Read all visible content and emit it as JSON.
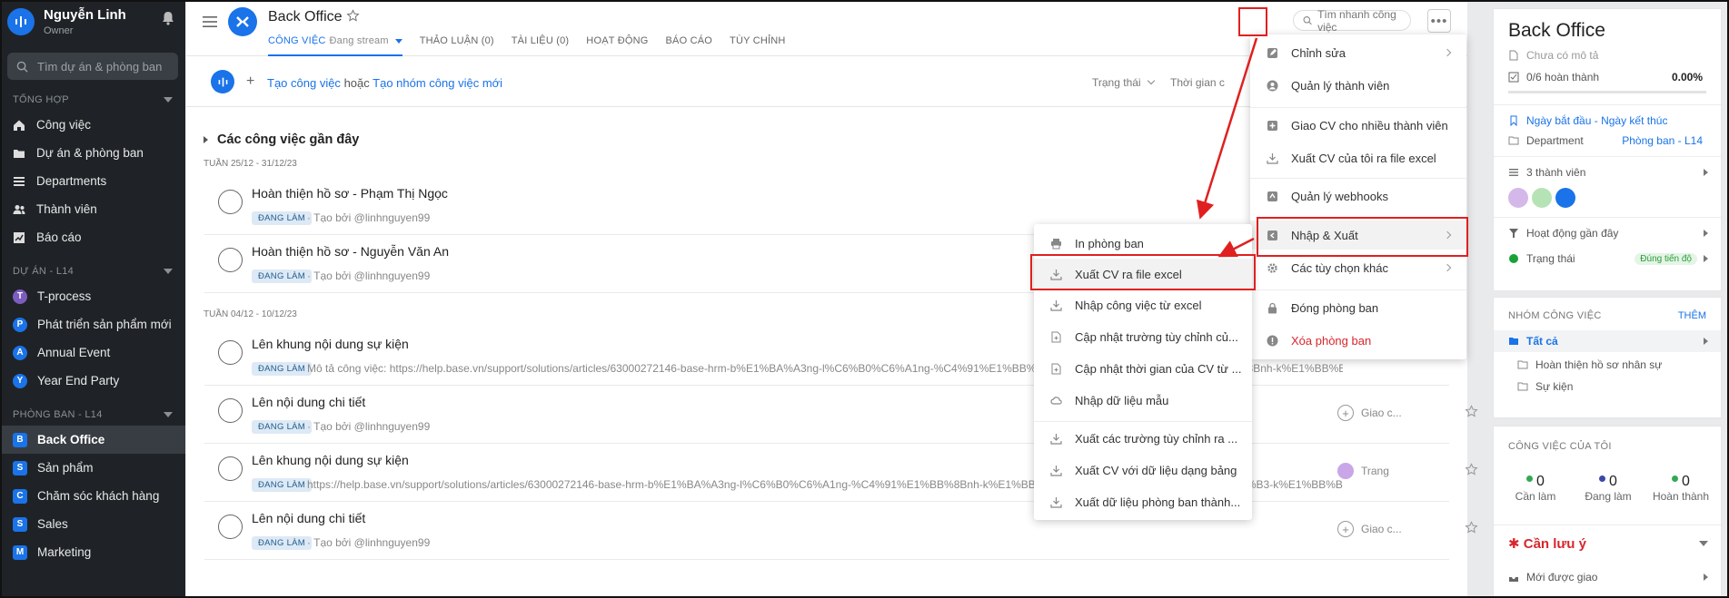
{
  "sidebar": {
    "user_name": "Nguyễn Linh",
    "user_role": "Owner",
    "search_placeholder": "Tìm dự án & phòng ban",
    "section_general": "TỔNG HỢP",
    "general_items": [
      {
        "label": "Công việc",
        "icon": "home-icon"
      },
      {
        "label": "Dự án & phòng ban",
        "icon": "folder-icon"
      },
      {
        "label": "Departments",
        "icon": "list-icon"
      },
      {
        "label": "Thành viên",
        "icon": "users-icon"
      },
      {
        "label": "Báo cáo",
        "icon": "chart-icon"
      }
    ],
    "section_projects": "DỰ ÁN - L14",
    "project_items": [
      {
        "label": "T-process",
        "badge": "T"
      },
      {
        "label": "Phát triển sản phẩm mới",
        "badge": "P"
      },
      {
        "label": "Annual Event",
        "badge": "A"
      },
      {
        "label": "Year End Party",
        "badge": "Y"
      }
    ],
    "section_departments": "PHÒNG BAN - L14",
    "department_items": [
      {
        "label": "Back Office",
        "badge": "B"
      },
      {
        "label": "Sản phẩm",
        "badge": "S"
      },
      {
        "label": "Chăm sóc khách hàng",
        "badge": "C"
      },
      {
        "label": "Sales",
        "badge": "S"
      },
      {
        "label": "Marketing",
        "badge": "M"
      }
    ]
  },
  "header": {
    "title": "Back Office",
    "tabs": [
      {
        "label": "CÔNG VIỆC",
        "sub": "Đang stream"
      },
      {
        "label": "THẢO LUẬN (0)"
      },
      {
        "label": "TÀI LIỆU (0)"
      },
      {
        "label": "HOẠT ĐỘNG"
      },
      {
        "label": "BÁO CÁO"
      },
      {
        "label": "TÙY CHỈNH"
      }
    ],
    "quick_search_placeholder": "Tìm nhanh công việc",
    "more_label": "•••"
  },
  "toolbar": {
    "create_task": "Tạo công việc",
    "or": "hoặc",
    "create_group": "Tạo nhóm công việc mới",
    "filter_status": "Trạng thái",
    "filter_time": "Thời gian c"
  },
  "tasks": {
    "group_title": "Các công việc gần đây",
    "weeks": [
      "TUẦN 25/12 - 31/12/23",
      "TUẦN 04/12 - 10/12/23"
    ],
    "items": [
      {
        "name": "Hoàn thiện hồ sơ - Phạm Thị Ngọc",
        "status": "ĐANG LÀM",
        "meta": "· Tạo bởi @linhnguyen99",
        "assignee": "",
        "star": false
      },
      {
        "name": "Hoàn thiện hồ sơ - Nguyễn Văn An",
        "status": "ĐANG LÀM",
        "meta": "· Tạo bởi @linhnguyen99",
        "assignee": "",
        "star": false
      },
      {
        "name": "Lên khung nội dung sự kiện",
        "status": "ĐANG LÀM",
        "meta": "Mô tả công việc: https://help.base.vn/support/solutions/articles/63000272146-base-hrm-b%E1%BA%A3ng-l%C6%B0%C6%A1ng-%C4%91%E1%BB%8Bnh-k%E1%BB%B3-%C4%91%E1%BB%8Bnh-k%E1%BB%B3-k%E1%BB%B3-nh%E1%BB%A9-nh%E1%BB%A9-n%E1%BB%95i-b%E1%BB%99t-%C4%91%E1%BB%8Bnh-k%E1%BB%B3-%E1%BB%99t%E1%BB%B8nh-k%E1%BB%B3%E1%BB%B8%E1%BB%B8%E1%BB%B8%E1%BB%B8%E1%BB%B8%E1%BB%B8%E1%BB%B8%E1%BB%B8%E1%BB%B8%E1%BB%BB",
        "assignee": "",
        "star": false
      },
      {
        "name": "Lên nội dung chi tiết",
        "status": "ĐANG LÀM",
        "meta": "· Tạo bởi @linhnguyen99",
        "assignee": "Giao c...",
        "star": true
      },
      {
        "name": "Lên khung nội dung sự kiện",
        "status": "ĐANG LÀM",
        "meta": "https://help.base.vn/support/solutions/articles/63000272146-base-hrm-b%E1%BA%A3ng-l%C6%B0%C6%A1ng-%C4%91%E1%BB%8Bnh-k%E1%BB%B3-%C4%91%E1%BB%8Bnh-k%E1%BB%B3-k%E1%BB%B3-nh%E1%BB%A9-nh%E1%BB%A9-n%E1%BB%95i-b%E1%BB%99t-%C4%91%E1%BB%8Bnh-k%E1%BB%B3-%E1%BB%99t%E1%BB%B8nh-k%E1%BB%B3%E1%BB%B8%E1%BB%B8%E1%BB%B8%E1%BB%B8%E1%BB%B8%E1%BB%B8%E1%BB%B8%E1%BB%B8%E1%BB%B8%E1%BB%A",
        "assignee": "Trang",
        "star": true
      },
      {
        "name": "Lên nội dung chi tiết",
        "status": "ĐANG LÀM",
        "meta": "· Tạo bởi @linhnguyen99",
        "assignee": "Giao c...",
        "star": true
      }
    ]
  },
  "more_menu": {
    "items": [
      {
        "label": "Chỉnh sửa",
        "icon": "edit-icon",
        "chevron": true
      },
      {
        "label": "Quản lý thành viên",
        "icon": "user-circle-icon"
      },
      {
        "label": "Giao CV cho nhiều thành viên",
        "icon": "plus-square-icon"
      },
      {
        "label": "Xuất CV của tôi ra file excel",
        "icon": "download-icon"
      },
      {
        "label": "Quản lý webhooks",
        "icon": "webhook-icon"
      },
      {
        "label": "Nhập & Xuất",
        "icon": "import-export-icon",
        "chevron": true
      },
      {
        "label": "Các tùy chọn khác",
        "icon": "gear-icon",
        "chevron": true
      },
      {
        "label": "Đóng phòng ban",
        "icon": "lock-icon"
      },
      {
        "label": "Xóa phòng ban",
        "icon": "alert-icon"
      }
    ]
  },
  "io_menu": {
    "items": [
      {
        "label": "In phòng ban",
        "icon": "printer-icon"
      },
      {
        "label": "Xuất CV ra file excel",
        "icon": "download-icon"
      },
      {
        "label": "Nhập công việc từ excel",
        "icon": "download-icon"
      },
      {
        "label": "Cập nhật trường tùy chỉnh củ...",
        "icon": "file-plus-icon"
      },
      {
        "label": "Cập nhật thời gian của CV từ ...",
        "icon": "file-plus-icon"
      },
      {
        "label": "Nhập dữ liệu mẫu",
        "icon": "cloud-icon"
      },
      {
        "label": "Xuất các trường tùy chỉnh ra ...",
        "icon": "download-icon"
      },
      {
        "label": "Xuất CV với dữ liệu dạng bảng",
        "icon": "download-icon"
      },
      {
        "label": "Xuất dữ liệu phòng ban thành...",
        "icon": "download-icon"
      }
    ]
  },
  "right_panel": {
    "title": "Back Office",
    "desc": "Chưa có mô tả",
    "progress_label": "0/6 hoàn thành",
    "progress_pct": "0.00%",
    "progress_value": 0,
    "start_date": "Ngày bắt đầu",
    "date_sep": "-",
    "end_date": "Ngày kết thúc",
    "dept_label": "Department",
    "dept_value": "Phòng ban - L14",
    "members": "3 thành viên",
    "recent_activity": "Hoạt động gần đây",
    "status_label": "Trạng thái",
    "status_value": "Đúng tiến độ",
    "groups_title": "NHÓM CÔNG VIỆC",
    "groups_add": "THÊM",
    "groups": [
      "Tất cả",
      "Hoàn thiện hồ sơ nhân sự",
      "Sự kiện"
    ],
    "my_tasks_title": "CÔNG VIỆC CỦA TÔI",
    "my_tasks": [
      {
        "value": "0",
        "label": "Cần làm",
        "color": "#34a853"
      },
      {
        "value": "0",
        "label": "Đang làm",
        "color": "#3949ab"
      },
      {
        "value": "0",
        "label": "Hoàn thành",
        "color": "#34a853"
      }
    ],
    "notice_title": "Cần lưu ý",
    "notice_item": "Mới được giao"
  },
  "colors": {
    "accent": "#1a73e8",
    "highlight": "#e02020",
    "sidebar_bg": "#1f2327"
  }
}
